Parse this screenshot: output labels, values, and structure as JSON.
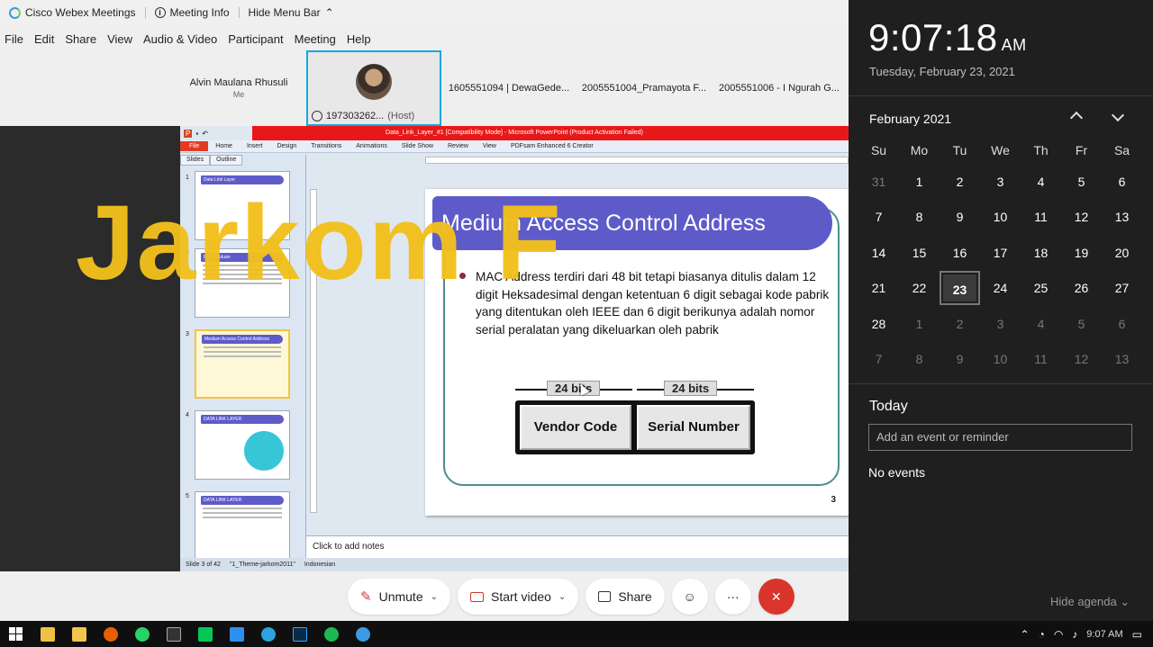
{
  "titlebar": {
    "app_name": "Cisco Webex Meetings",
    "meeting_info": "Meeting Info",
    "hide_menu": "Hide Menu Bar"
  },
  "menu": [
    "File",
    "Edit",
    "Share",
    "View",
    "Audio & Video",
    "Participant",
    "Meeting",
    "Help"
  ],
  "participants": [
    {
      "name": "Alvin Maulana Rhusuli",
      "sub": "Me"
    },
    {
      "name": "197303262...",
      "host": "(Host)"
    },
    {
      "name": "1605551094 | DewaGede..."
    },
    {
      "name": "2005551004_Pramayota F..."
    },
    {
      "name": "2005551006 - I Ngurah G..."
    }
  ],
  "ppt": {
    "window_title": "Data_Link_Layer_#1 [Compatibility Mode] - Microsoft PowerPoint (Product Activation Failed)",
    "tabs": [
      "File",
      "Home",
      "Insert",
      "Design",
      "Transitions",
      "Animations",
      "Slide Show",
      "Review",
      "View",
      "PDFsam Enhanced 6 Creator"
    ],
    "pane_tabs": [
      "Slides",
      "Outline"
    ],
    "thumbs": [
      {
        "num": "1",
        "title": "Data Link Layer"
      },
      {
        "num": "2",
        "title": "Pendahuluan"
      },
      {
        "num": "3",
        "title": "Medium Access Control Address"
      },
      {
        "num": "4",
        "title": "DATA LINK LAYER"
      },
      {
        "num": "5",
        "title": "DATA LINK LAYER"
      }
    ],
    "slide": {
      "title": "Medium Access Control Address",
      "body": "MAC Address terdiri dari 48 bit tetapi biasanya ditulis dalam 12 digit Heksadesimal dengan ketentuan 6 digit sebagai kode pabrik yang ditentukan oleh IEEE dan 6 digit berikunya adalah nomor serial peralatan yang dikeluarkan oleh pabrik",
      "bits_left": "24 bits",
      "bits_right": "24 bits",
      "cell_left": "Vendor Code",
      "cell_right": "Serial Number",
      "page": "3"
    },
    "notes": "Click to add notes",
    "status": {
      "slide": "Slide 3 of 42",
      "theme": "\"1_Theme-jarkom2011\"",
      "lang": "Indonesian"
    }
  },
  "watermark": "Jarkom F",
  "controls": {
    "unmute": "Unmute",
    "start_video": "Start video",
    "share": "Share"
  },
  "flyout": {
    "time": "9:07:18",
    "ampm": "AM",
    "date": "Tuesday, February 23, 2021",
    "month": "February 2021",
    "weekdays": [
      "Su",
      "Mo",
      "Tu",
      "We",
      "Th",
      "Fr",
      "Sa"
    ],
    "weeks": [
      [
        "31",
        "1",
        "2",
        "3",
        "4",
        "5",
        "6"
      ],
      [
        "7",
        "8",
        "9",
        "10",
        "11",
        "12",
        "13"
      ],
      [
        "14",
        "15",
        "16",
        "17",
        "18",
        "19",
        "20"
      ],
      [
        "21",
        "22",
        "23",
        "24",
        "25",
        "26",
        "27"
      ],
      [
        "28",
        "1",
        "2",
        "3",
        "4",
        "5",
        "6"
      ],
      [
        "7",
        "8",
        "9",
        "10",
        "11",
        "12",
        "13"
      ]
    ],
    "today_label": "Today",
    "event_placeholder": "Add an event or reminder",
    "no_events": "No events",
    "hide_agenda": "Hide agenda"
  },
  "taskbar": {
    "time": "9:07 AM"
  },
  "colors": {
    "accent": "#14a8e0",
    "end_call": "#d9352c",
    "slide_title": "#5e5bc9",
    "watermark": "#f2c01c"
  }
}
